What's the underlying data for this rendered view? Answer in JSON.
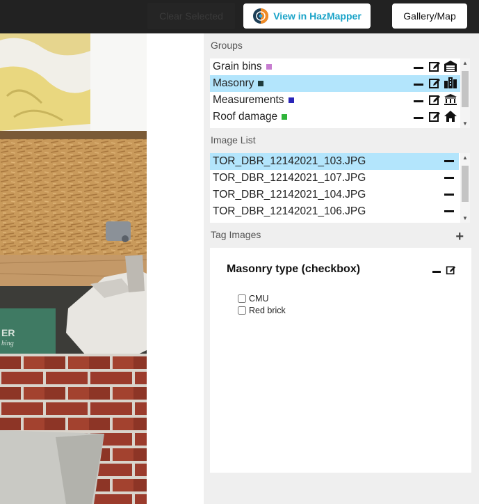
{
  "toolbar": {
    "clear_label": "Clear Selected",
    "hazmapper_label": "View in HazMapper",
    "gallery_label": "Gallery/Map"
  },
  "groups": {
    "label": "Groups",
    "items": [
      {
        "name": "Grain bins",
        "color": "#c77dd0",
        "icon": "warehouse-icon",
        "selected": false
      },
      {
        "name": "Masonry",
        "color": "#1f3b3b",
        "icon": "city-buildings-icon",
        "selected": true
      },
      {
        "name": "Measurements",
        "color": "#2a25b8",
        "icon": "landmark-icon",
        "selected": false
      },
      {
        "name": "Roof damage",
        "color": "#2fb43a",
        "icon": "house-icon",
        "selected": false
      }
    ]
  },
  "image_list": {
    "label": "Image List",
    "items": [
      {
        "name": "TOR_DBR_12142021_103.JPG",
        "selected": true
      },
      {
        "name": "TOR_DBR_12142021_107.JPG",
        "selected": false
      },
      {
        "name": "TOR_DBR_12142021_104.JPG",
        "selected": false
      },
      {
        "name": "TOR_DBR_12142021_106.JPG",
        "selected": false
      }
    ]
  },
  "tag_images": {
    "label": "Tag Images",
    "card_title": "Masonry type (checkbox)",
    "options": [
      "CMU",
      "Red brick"
    ]
  }
}
